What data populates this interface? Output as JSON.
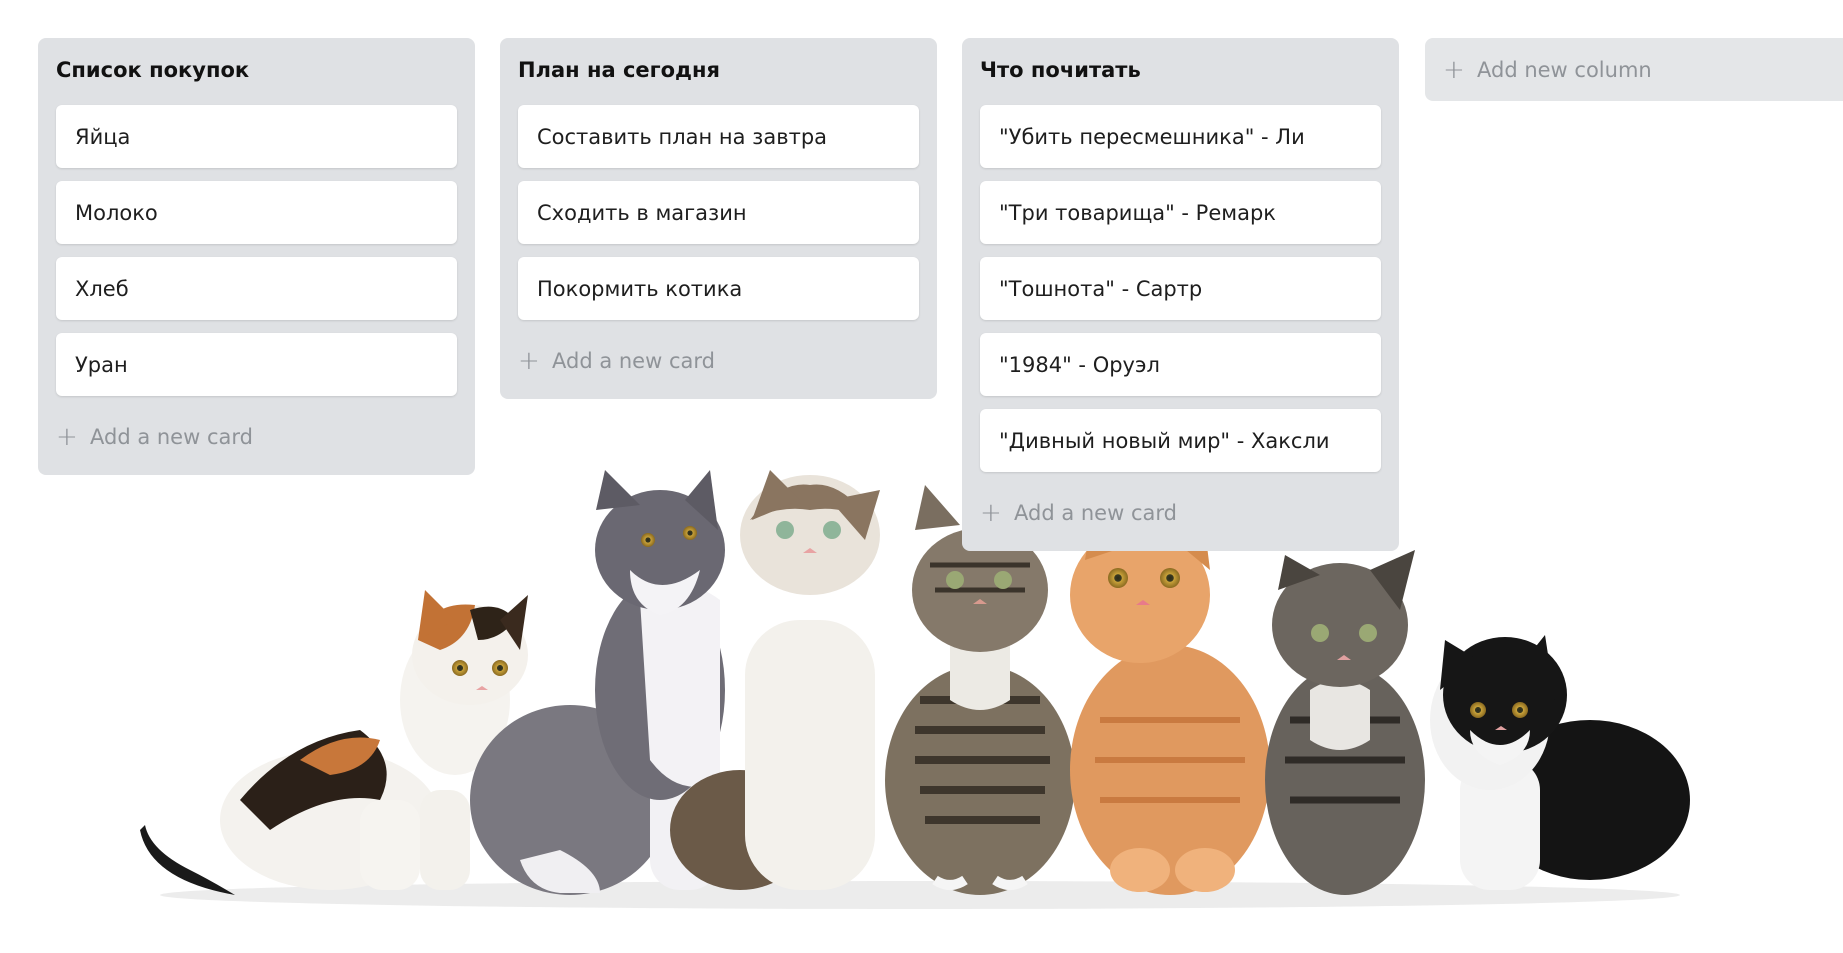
{
  "columns": [
    {
      "title": "Список покупок",
      "cards": [
        "Яйца",
        "Молоко",
        "Хлеб",
        "Уран"
      ],
      "add_label": "Add a new card"
    },
    {
      "title": "План на сегодня",
      "cards": [
        "Составить план на завтра",
        "Сходить в магазин",
        "Покормить котика"
      ],
      "add_label": "Add a new card"
    },
    {
      "title": "Что почитать",
      "cards": [
        "\"Убить пересмешника\" - Ли",
        "\"Три товарища\" - Ремарк",
        "\"Тошнота\" - Сартр",
        "\"1984\" - Оруэл",
        "\"Дивный новый мир\" - Хаксли"
      ],
      "add_label": "Add a new card"
    }
  ],
  "add_column_label": "Add new column",
  "icons": {
    "plus": "+"
  },
  "colors": {
    "column_bg": "#dfe1e4",
    "card_bg": "#ffffff",
    "muted_text": "#8f9398"
  }
}
